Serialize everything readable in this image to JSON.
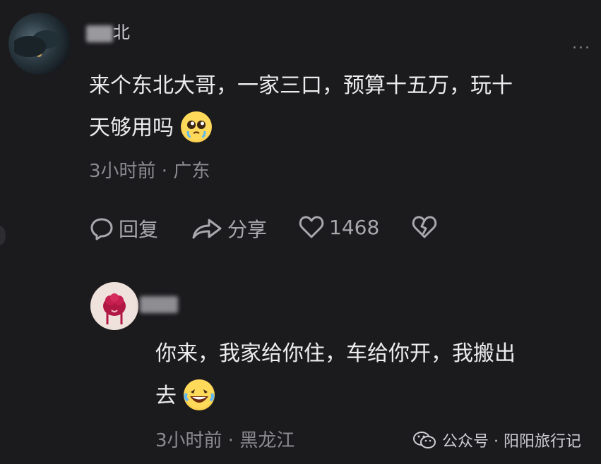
{
  "comment1": {
    "avatar": "night-scene-avatar",
    "username": "北",
    "text_line1": "来个东北大哥，一家三口，预算十五万，玩十",
    "text_line2": "天够用吗",
    "emoji": "pleading-face-emoji",
    "meta": "3小时前 · 广东",
    "actions": {
      "reply": "回复",
      "share": "分享",
      "likes": "1468"
    },
    "more": "···"
  },
  "comment2": {
    "avatar": "pink-flower-avatar",
    "username": "",
    "text_line1": "你来，我家给你住，车给你开，我搬出",
    "text_line2": "去",
    "emoji": "rolling-laughing-emoji",
    "meta": "3小时前 · 黑龙江"
  },
  "watermark": {
    "text": "公众号 · 阳阳旅行记",
    "icon": "wechat-icon"
  },
  "colors": {
    "background": "#1b1a1d",
    "text": "#ececee",
    "meta": "#8c8b90"
  }
}
